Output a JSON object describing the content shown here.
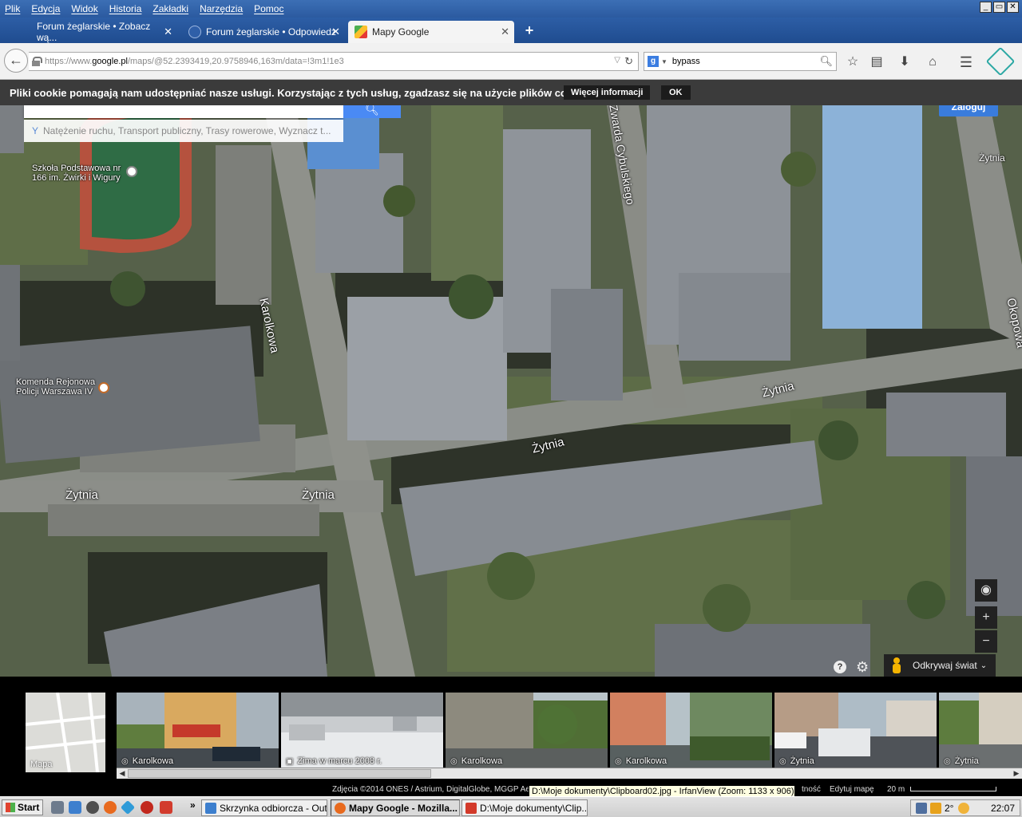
{
  "menubar": {
    "items": [
      "Plik",
      "Edycja",
      "Widok",
      "Historia",
      "Zakładki",
      "Narzędzia",
      "Pomoc"
    ],
    "window_controls": [
      "_",
      "▭",
      "✕"
    ]
  },
  "tabs": [
    {
      "label": "Forum żeglarskie • Zobacz wą...",
      "active": false
    },
    {
      "label": "Forum żeglarskie • Odpowiedz",
      "active": false
    },
    {
      "label": "Mapy Google",
      "active": true
    }
  ],
  "nav": {
    "url_prefix": "https://www.",
    "url_domain": "google.pl",
    "url_path": "/maps/@52.2393419,20.9758946,163m/data=!3m1!1e3",
    "search_value": "bypass",
    "icons": [
      "star-icon",
      "reading-list-icon",
      "download-icon",
      "home-icon",
      "menu-icon",
      "addon-icon"
    ]
  },
  "cookie": {
    "text": "Pliki cookie pomagają nam udostępniać nasze usługi. Korzystając z tych usług, zgadzasz się na użycie plików cookie.",
    "more_label": "Więcej informacji",
    "ok_label": "OK"
  },
  "map": {
    "layers_hint": "Natężenie ruchu, Transport publiczny, Trasy rowerowe, Wyznacz t...",
    "login_label": "Zaloguj",
    "streets": {
      "karolkowa": "Karolkowa",
      "zytnia_1": "Żytnia",
      "zytnia_2": "Żytnia",
      "zytnia_3": "Żytnia",
      "zytnia_4": "Żytnia",
      "zytnia_5": "Żytnia",
      "cybulskiego": "Zwarda Cybulskiego",
      "okopowa": "Okopowa"
    },
    "pois": {
      "school_line1": "Szkoła Podstawowa nr",
      "school_line2": "166 im. Żwirki i Wigury",
      "police_line1": "Komenda Rejonowa",
      "police_line2": "Policji Warszawa IV"
    },
    "controls": {
      "zoom_in": "+",
      "zoom_out": "−",
      "location": "◉"
    },
    "explore_label": "Odkrywaj świat",
    "help": "?"
  },
  "photostrip": {
    "minimap_label": "Mapa",
    "photos": [
      {
        "caption": "Karolkowa",
        "type": "360"
      },
      {
        "caption": "Zima w marcu 2008 r.",
        "type": "photo"
      },
      {
        "caption": "Karolkowa",
        "type": "360"
      },
      {
        "caption": "Karolkowa",
        "type": "360"
      },
      {
        "caption": "Żytnia",
        "type": "360"
      },
      {
        "caption": "Żytnia",
        "type": "360"
      }
    ]
  },
  "attribution": {
    "text": "Zdjęcia ©2014 ONES / Astrium, DigitalGlobe, MGGP Ae",
    "report": "tność",
    "edit": "Edytuj mapę",
    "scale": "20 m"
  },
  "tooltip": "D:\\Moje dokumenty\\Clipboard02.jpg - IrfanView (Zoom: 1133 x 906)",
  "taskbar": {
    "start": "Start",
    "more": "»",
    "tasks": [
      {
        "label": "Skrzynka odbiorcza - Out...",
        "active": false
      },
      {
        "label": "Mapy Google - Mozilla...",
        "active": true
      },
      {
        "label": "D:\\Moje dokumenty\\Clip...",
        "active": false
      }
    ],
    "tray_temp": "2°",
    "clock": "22:07"
  }
}
